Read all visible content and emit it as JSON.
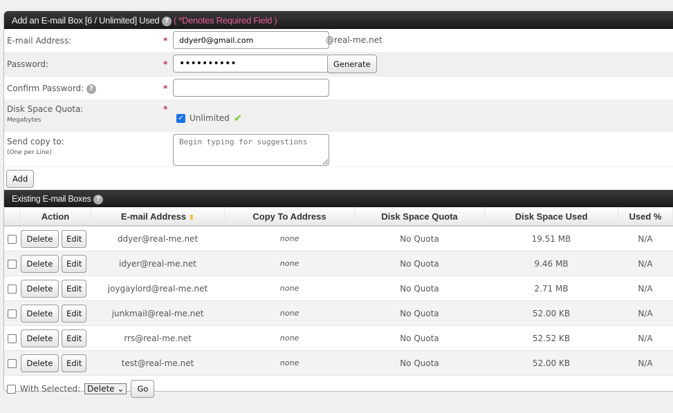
{
  "add_box": {
    "title": "Add an E-mail Box [6 / Unlimited] Used",
    "required_note": "( *Denotes Required Field )",
    "email_label": "E-mail Address:",
    "email_value": "ddyer0@gmail.com",
    "domain": "@real-me.net",
    "password_label": "Password:",
    "password_value": "••••••••••",
    "generate_label": "Generate",
    "confirm_label": "Confirm Password:",
    "quota_label": "Disk Space Quota:",
    "quota_sub": "Megabytes",
    "unlimited_label": "Unlimited",
    "copy_label": "Send copy to:",
    "copy_sub": "(One per Line)",
    "copy_placeholder": "Begin typing for suggestions",
    "add_label": "Add",
    "star": "*",
    "help": "?"
  },
  "existing": {
    "title": "Existing E-mail Boxes",
    "columns": [
      "Action",
      "E-mail Address",
      "Copy To Address",
      "Disk Space Quota",
      "Disk Space Used",
      "Used %"
    ],
    "delete_label": "Delete",
    "edit_label": "Edit",
    "rows": [
      {
        "email": "ddyer@real-me.net",
        "copy": "none",
        "quota": "No Quota",
        "used": "19.51 MB",
        "pct": "N/A"
      },
      {
        "email": "idyer@real-me.net",
        "copy": "none",
        "quota": "No Quota",
        "used": "9.46 MB",
        "pct": "N/A"
      },
      {
        "email": "joygaylord@real-me.net",
        "copy": "none",
        "quota": "No Quota",
        "used": "2.71 MB",
        "pct": "N/A"
      },
      {
        "email": "junkmail@real-me.net",
        "copy": "none",
        "quota": "No Quota",
        "used": "52.00 KB",
        "pct": "N/A"
      },
      {
        "email": "rrs@real-me.net",
        "copy": "none",
        "quota": "No Quota",
        "used": "52.52 KB",
        "pct": "N/A"
      },
      {
        "email": "test@real-me.net",
        "copy": "none",
        "quota": "No Quota",
        "used": "52.00 KB",
        "pct": "N/A"
      }
    ],
    "with_selected_label": "With Selected:",
    "bulk_action": "Delete",
    "go_label": "Go"
  }
}
